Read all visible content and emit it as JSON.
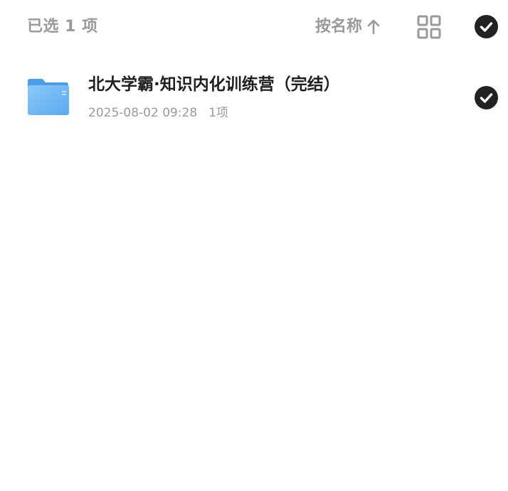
{
  "header": {
    "selected_label": "已选 1 项",
    "sort_label": "按名称",
    "sort_direction_icon": "arrow-up-icon",
    "view_toggle_icon": "grid-view-icon",
    "select_all_icon": "check-circle-icon",
    "select_all_checked": true
  },
  "files": [
    {
      "type_icon": "folder-icon",
      "name": "北大学霸·知识内化训练营（完结）",
      "modified": "2025-08-02 09:28",
      "item_count": "1项",
      "checked": true
    }
  ],
  "colors": {
    "muted_text": "#999999",
    "primary_text": "#1f1f1f",
    "check_fill": "#222222",
    "folder_blue": "#6fb7f3"
  }
}
